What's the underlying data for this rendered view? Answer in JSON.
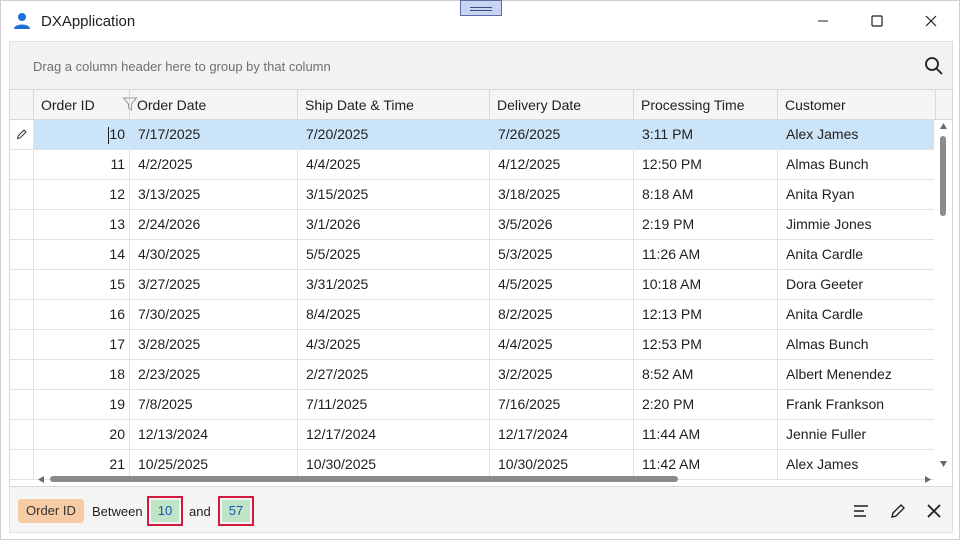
{
  "window": {
    "title": "DXApplication"
  },
  "group_panel": {
    "text": "Drag a column header here to group by that column"
  },
  "columns": [
    {
      "label": "Order ID"
    },
    {
      "label": "Order Date"
    },
    {
      "label": "Ship Date & Time"
    },
    {
      "label": "Delivery Date"
    },
    {
      "label": "Processing Time"
    },
    {
      "label": "Customer"
    }
  ],
  "rows": [
    [
      "10",
      "7/17/2025",
      "7/20/2025",
      "7/26/2025",
      "3:11 PM",
      "Alex James"
    ],
    [
      "11",
      "4/2/2025",
      "4/4/2025",
      "4/12/2025",
      "12:50 PM",
      "Almas Bunch"
    ],
    [
      "12",
      "3/13/2025",
      "3/15/2025",
      "3/18/2025",
      "8:18 AM",
      "Anita Ryan"
    ],
    [
      "13",
      "2/24/2026",
      "3/1/2026",
      "3/5/2026",
      "2:19 PM",
      "Jimmie Jones"
    ],
    [
      "14",
      "4/30/2025",
      "5/5/2025",
      "5/3/2025",
      "11:26 AM",
      "Anita Cardle"
    ],
    [
      "15",
      "3/27/2025",
      "3/31/2025",
      "4/5/2025",
      "10:18 AM",
      "Dora Geeter"
    ],
    [
      "16",
      "7/30/2025",
      "8/4/2025",
      "8/2/2025",
      "12:13 PM",
      "Anita Cardle"
    ],
    [
      "17",
      "3/28/2025",
      "4/3/2025",
      "4/4/2025",
      "12:53 PM",
      "Almas Bunch"
    ],
    [
      "18",
      "2/23/2025",
      "2/27/2025",
      "3/2/2025",
      "8:52 AM",
      "Albert Menendez"
    ],
    [
      "19",
      "7/8/2025",
      "7/11/2025",
      "7/16/2025",
      "2:20 PM",
      "Frank Frankson"
    ],
    [
      "20",
      "12/13/2024",
      "12/17/2024",
      "12/17/2024",
      "11:44 AM",
      "Jennie Fuller"
    ],
    [
      "21",
      "10/25/2025",
      "10/30/2025",
      "10/30/2025",
      "11:42 AM",
      "Alex James"
    ]
  ],
  "filter_panel": {
    "field": "Order ID",
    "operator": "Between",
    "value_from": "10",
    "conjunction": "and",
    "value_to": "57"
  },
  "colors": {
    "focused_row": "#cce4f7",
    "chip": "#f7cba3",
    "value_bg": "#bfe4c6",
    "value_border": "#d01c3a"
  },
  "icons": [
    "user-icon",
    "minimize-icon",
    "maximize-icon",
    "close-icon",
    "search-icon",
    "filter-icon",
    "edit-pencil-icon",
    "filter-editor-icon",
    "edit-filter-icon",
    "clear-filter-icon"
  ]
}
